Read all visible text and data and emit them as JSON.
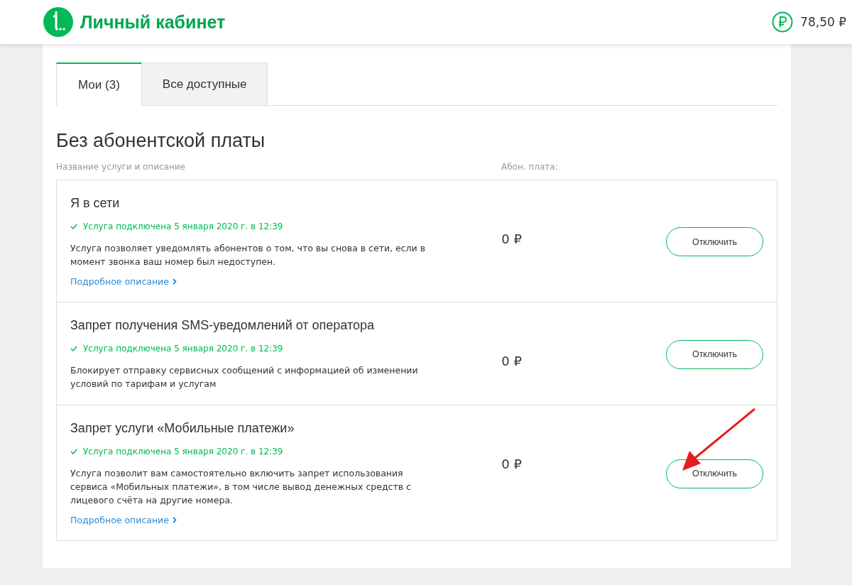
{
  "header": {
    "title": "Личный кабинет",
    "balance": "78,50 ₽"
  },
  "tabs": [
    {
      "label": "Мои (3)",
      "selected": true
    },
    {
      "label": "Все доступные",
      "selected": false
    }
  ],
  "section": {
    "title": "Без абонентской платы",
    "columns": [
      "Название услуги и описание",
      "Абон. плата:"
    ]
  },
  "services": [
    {
      "name": "Я в сети",
      "status": "Услуга подключена 5 января 2020 г. в 12:39",
      "description": "Услуга позволяет уведомлять абонентов о том, что вы снова в сети, если в момент звонка ваш номер был недоступен.",
      "link": "Подробное описание",
      "price": "0 ₽",
      "button": "Отключить",
      "annotated": false
    },
    {
      "name": "Запрет получения SMS-уведомлений от оператора",
      "status": "Услуга подключена 5 января 2020 г. в 12:39",
      "description": "Блокирует отправку сервисных сообщений с информацией об изменении условий по тарифам и услугам",
      "price": "0 ₽",
      "button": "Отключить",
      "annotated": false
    },
    {
      "name": "Запрет услуги «Мобильные платежи»",
      "status": "Услуга подключена 5 января 2020 г. в 12:39",
      "description": "Услуга позволит вам самостоятельно включить запрет использования сервиса «Мобильных платежи», в том числе вывод денежных средств с лицевого счёта на другие номера.",
      "link": "Подробное описание",
      "price": "0 ₽",
      "button": "Отключить",
      "annotated": true
    }
  ]
}
